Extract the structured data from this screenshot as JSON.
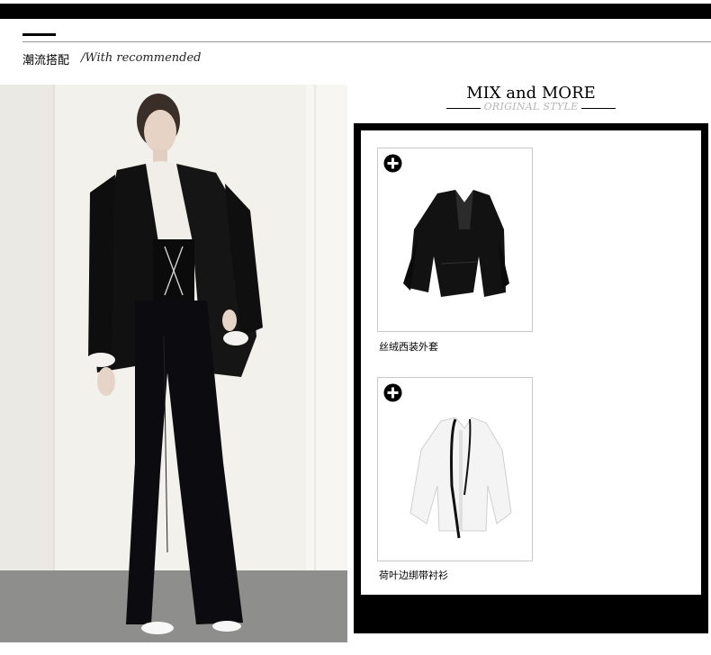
{
  "section": {
    "title": "潮流搭配",
    "subtitle": "/With recommended"
  },
  "mix": {
    "title": "MIX and MORE",
    "subtitle": "ORIGINAL STYLE"
  },
  "products": [
    {
      "name": "丝绒西装外套",
      "icon": "plus-icon"
    },
    {
      "name": "荷叶边绑带衬衫",
      "icon": "plus-icon"
    }
  ],
  "colors": {
    "accent": "#000000",
    "subtitle_gray": "#b5b5b5",
    "card_border": "#c9c9c9"
  }
}
